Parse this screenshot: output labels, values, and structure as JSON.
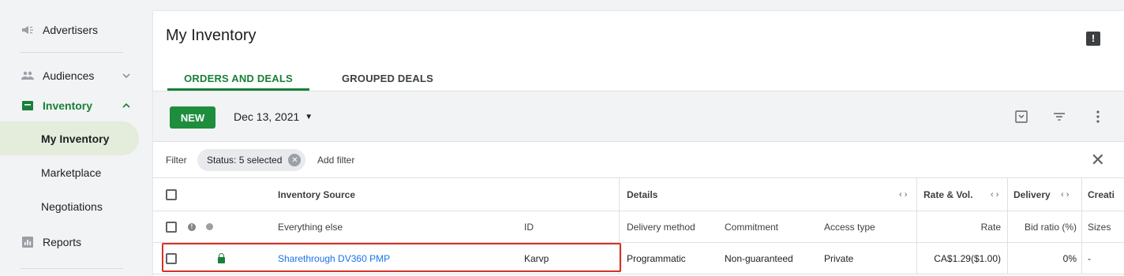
{
  "sidebar": {
    "items": [
      {
        "label": "Advertisers",
        "icon": "megaphone-icon"
      },
      {
        "label": "Audiences",
        "icon": "people-icon"
      },
      {
        "label": "Inventory",
        "icon": "inventory-icon"
      },
      {
        "label": "Reports",
        "icon": "bar-chart-icon"
      }
    ],
    "subitems": [
      "My Inventory",
      "Marketplace",
      "Negotiations"
    ]
  },
  "main": {
    "title": "My Inventory",
    "tabs": [
      "ORDERS AND DEALS",
      "GROUPED DEALS"
    ],
    "new_button": "NEW",
    "date": "Dec 13, 2021",
    "filter": {
      "label": "Filter",
      "chip": "Status: 5 selected",
      "add": "Add filter"
    }
  },
  "table": {
    "group_headers": {
      "inventory_source": "Inventory Source",
      "details": "Details",
      "rate_vol": "Rate & Vol.",
      "delivery": "Delivery",
      "creative": "Creati"
    },
    "columns": {
      "name": "Everything else",
      "id": "ID",
      "delivery_method": "Delivery method",
      "commitment": "Commitment",
      "access_type": "Access type",
      "rate": "Rate",
      "bid_ratio": "Bid ratio (%)",
      "sizes": "Sizes"
    },
    "rows": [
      {
        "name": "Sharethrough DV360 PMP",
        "id": "Karvp",
        "delivery_method": "Programmatic",
        "commitment": "Non-guaranteed",
        "access_type": "Private",
        "rate": "CA$1.29($1.00)",
        "bid_ratio": "0%",
        "sizes": "-"
      }
    ]
  },
  "colors": {
    "accent_green": "#188038",
    "button_green": "#1e8e3e",
    "link_blue": "#1a73e8",
    "highlight_red": "#d93025"
  }
}
